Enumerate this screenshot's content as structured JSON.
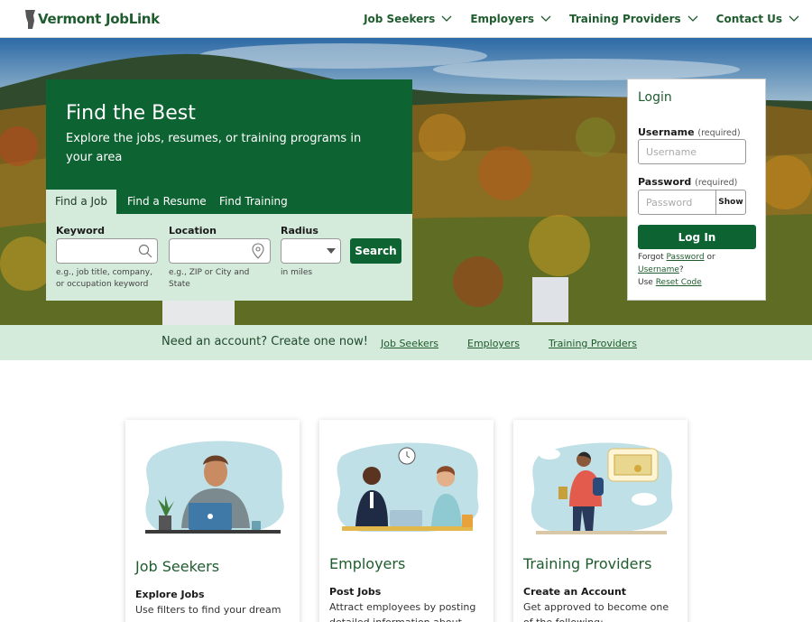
{
  "header": {
    "logo_text": "Vermont JobLink",
    "nav": [
      {
        "label": "Job Seekers"
      },
      {
        "label": "Employers"
      },
      {
        "label": "Training Providers"
      },
      {
        "label": "Contact Us"
      }
    ]
  },
  "search": {
    "title": "Find the Best",
    "subtitle": "Explore the jobs, resumes, or training programs in your area",
    "tabs": [
      {
        "label": "Find a Job",
        "active": true
      },
      {
        "label": "Find a Resume",
        "active": false
      },
      {
        "label": "Find Training",
        "active": false
      }
    ],
    "keyword_label": "Keyword",
    "keyword_help": "e.g., job title, company, or occupation keyword",
    "location_label": "Location",
    "location_help": "e.g., ZIP or City and State",
    "radius_label": "Radius",
    "radius_help": "in miles",
    "search_button": "Search"
  },
  "login": {
    "title": "Login",
    "username_label": "Username",
    "username_req": "(required)",
    "username_placeholder": "Username",
    "password_label": "Password",
    "password_req": "(required)",
    "password_placeholder": "Password",
    "show_button": "Show",
    "login_button": "Log In",
    "forgot_prefix": "Forgot",
    "forgot_password": "Password",
    "forgot_or": "or",
    "forgot_username": "Username",
    "forgot_q": "?",
    "use_prefix": "Use",
    "reset_code": "Reset Code"
  },
  "account_bar": {
    "text": "Need an account? Create one now!",
    "links": [
      {
        "label": "Job Seekers"
      },
      {
        "label": "Employers"
      },
      {
        "label": "Training Providers"
      }
    ]
  },
  "cards": [
    {
      "title": "Job Seekers",
      "subheading": "Explore Jobs",
      "text": "Use filters to find your dream"
    },
    {
      "title": "Employers",
      "subheading": "Post Jobs",
      "text": "Attract employees by posting detailed information about open"
    },
    {
      "title": "Training Providers",
      "subheading": "Create an Account",
      "text": "Get approved to become one of the following:"
    }
  ],
  "colors": {
    "brand_green": "#0e6332",
    "light_green": "#d4eadb",
    "text_green": "#1f5c2e"
  }
}
